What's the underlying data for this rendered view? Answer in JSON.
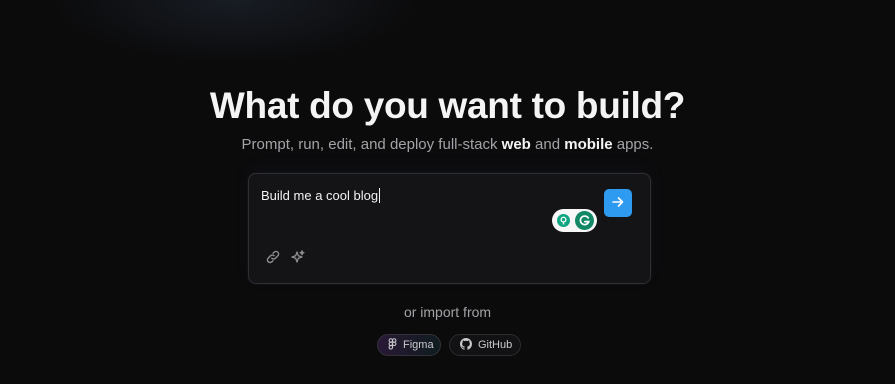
{
  "hero": {
    "title": "What do you want to build?",
    "subtitle_prefix": "Prompt, run, edit, and deploy full-stack ",
    "subtitle_web": "web",
    "subtitle_and": " and ",
    "subtitle_mobile": "mobile",
    "subtitle_suffix": " apps."
  },
  "prompt": {
    "value": "Build me a cool blog",
    "send_icon": "arrow-right-icon",
    "tools": [
      "link-icon",
      "sparkles-icon"
    ]
  },
  "import": {
    "label": "or import from",
    "options": [
      {
        "label": "Figma",
        "icon": "figma-icon"
      },
      {
        "label": "GitHub",
        "icon": "github-icon"
      }
    ]
  },
  "colors": {
    "background": "#0b0b0c",
    "accent": "#2e9bf0",
    "grammarly_green": "#128866"
  }
}
